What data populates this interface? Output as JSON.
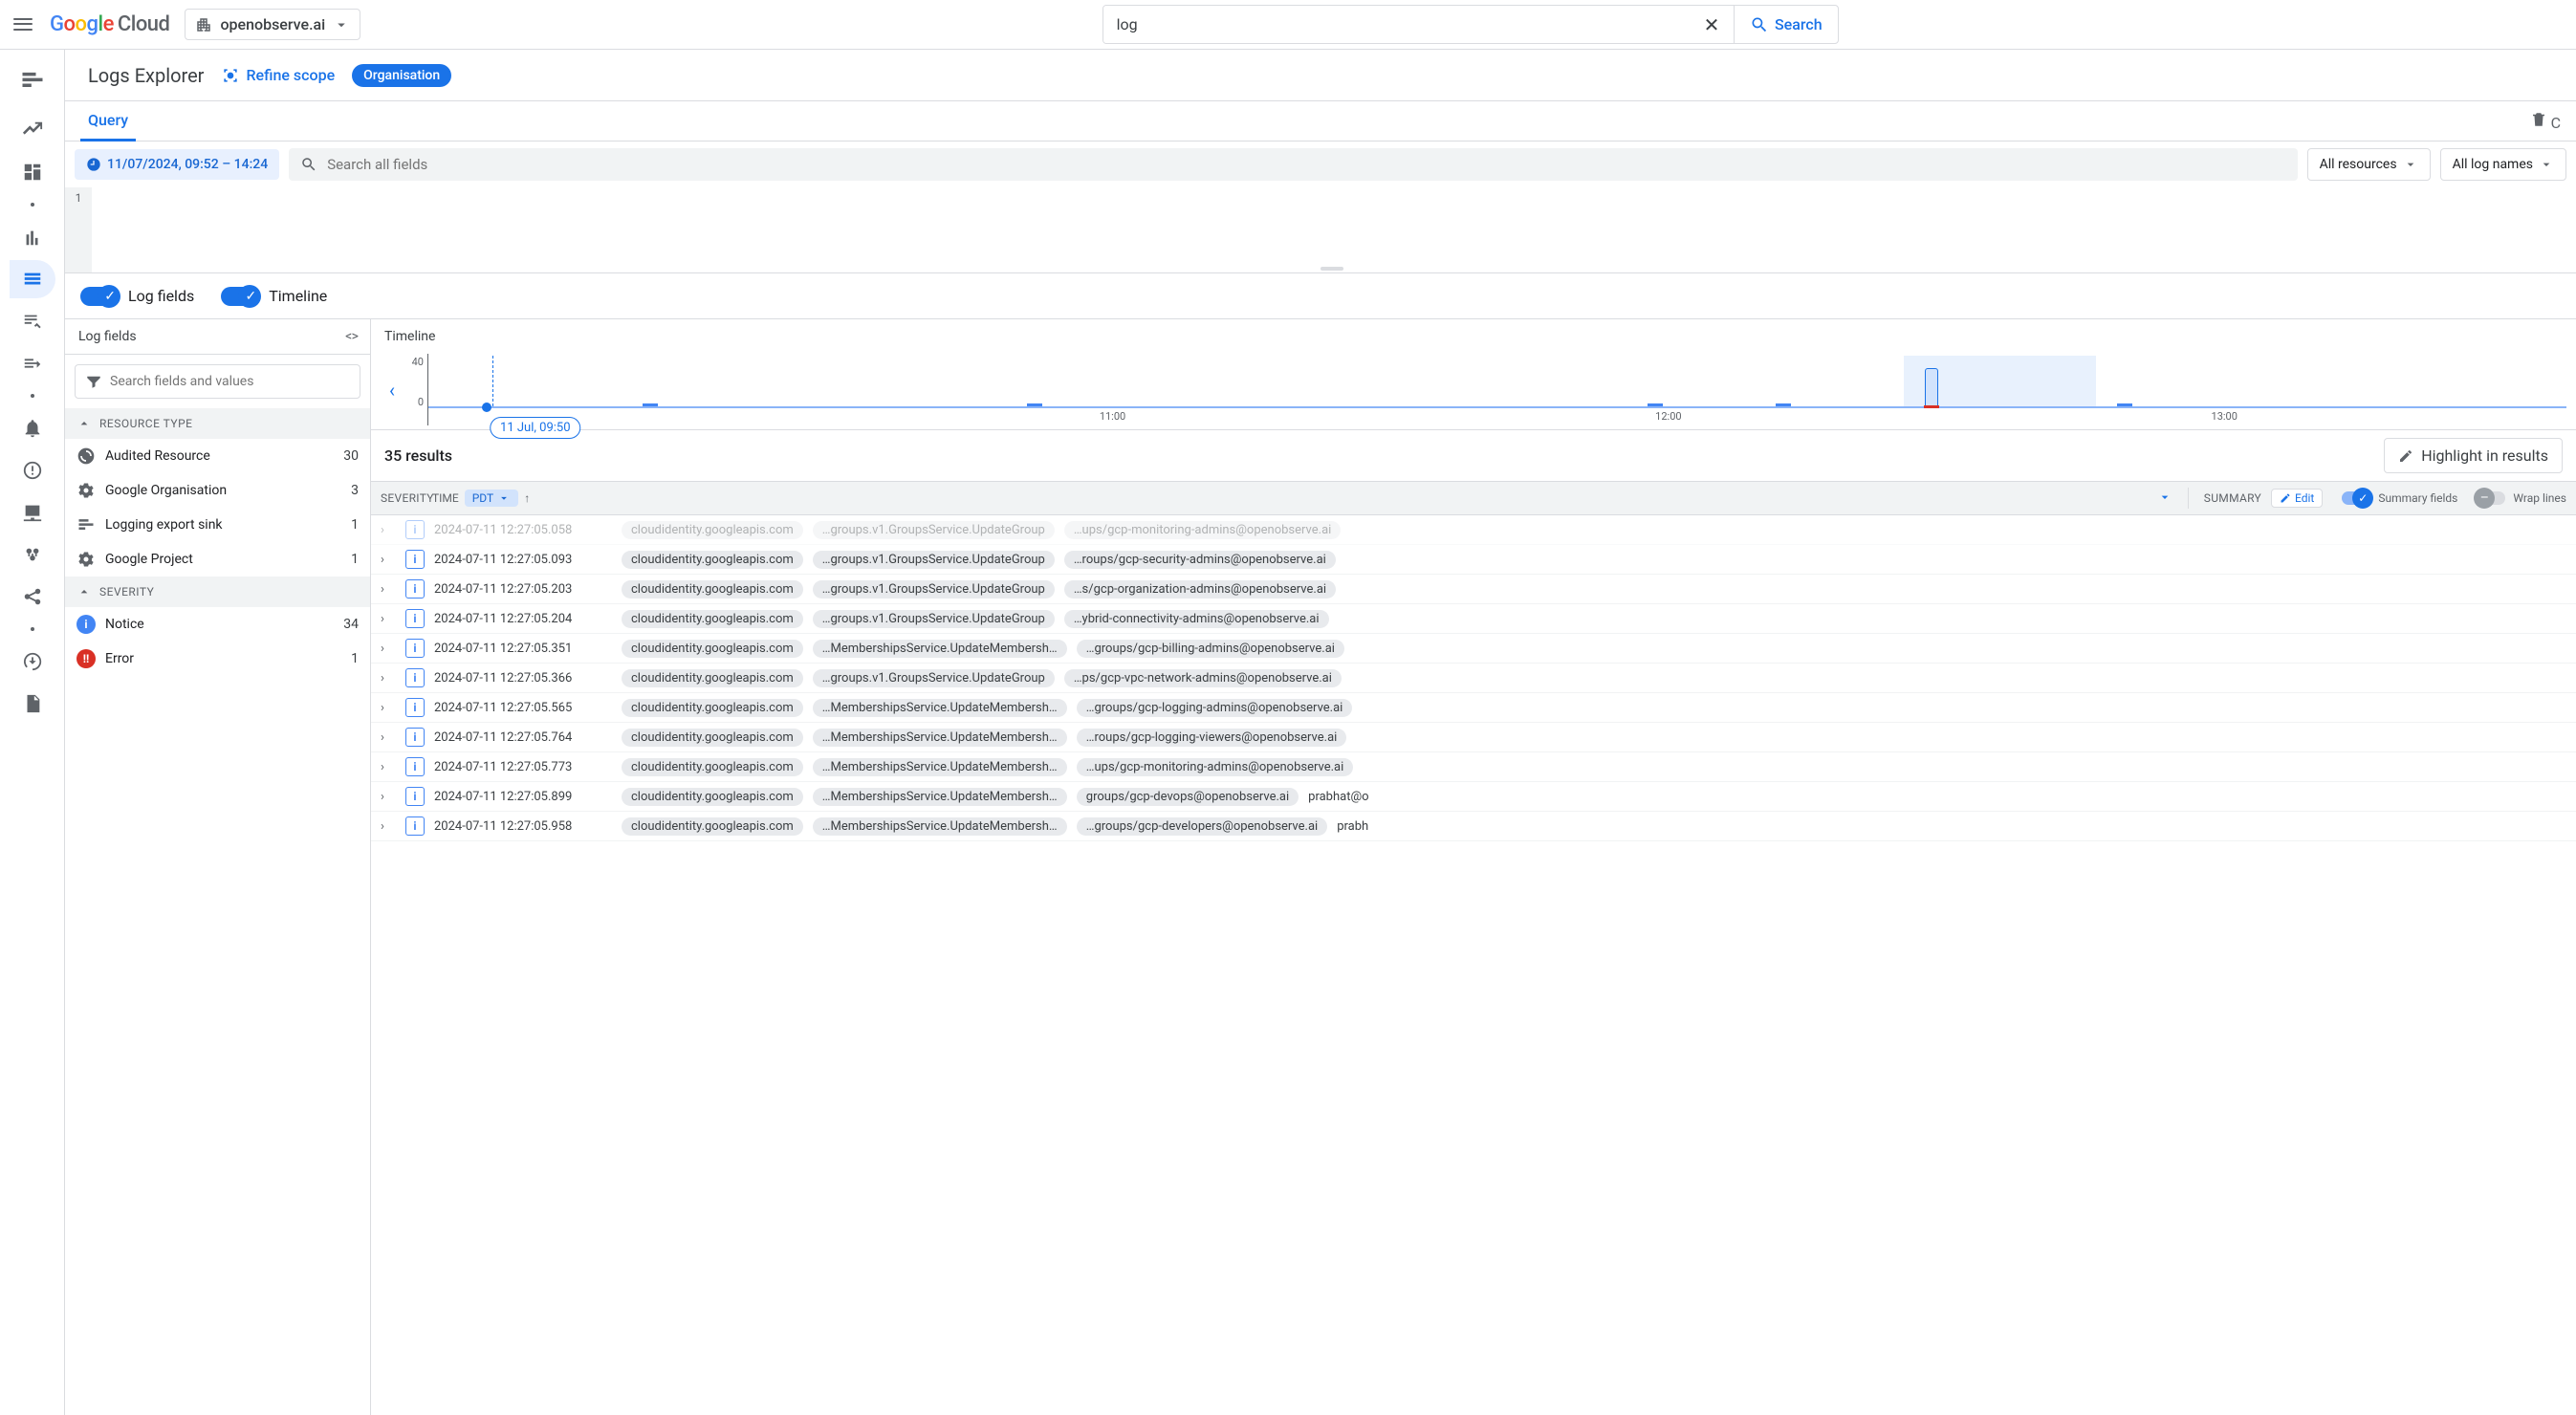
{
  "topbar": {
    "logo_text": "Google Cloud",
    "project": "openobserve.ai",
    "search_value": "log",
    "search_button": "Search"
  },
  "page": {
    "title": "Logs Explorer",
    "refine_scope": "Refine scope",
    "scope_badge": "Organisation",
    "query_tab": "Query",
    "clear_label": "C"
  },
  "filters": {
    "time_range": "11/07/2024, 09:52 – 14:24",
    "search_placeholder": "Search all fields",
    "resources_dd": "All resources",
    "lognames_dd": "All log names",
    "editor_line": "1"
  },
  "toggles": {
    "log_fields": "Log fields",
    "timeline": "Timeline"
  },
  "fields_panel": {
    "header": "Log fields",
    "search_placeholder": "Search fields and values",
    "groups": [
      {
        "name": "RESOURCE TYPE",
        "items": [
          {
            "icon": "audited",
            "label": "Audited Resource",
            "count": "30"
          },
          {
            "icon": "gear",
            "label": "Google Organisation",
            "count": "3"
          },
          {
            "icon": "sink",
            "label": "Logging export sink",
            "count": "1"
          },
          {
            "icon": "gear",
            "label": "Google Project",
            "count": "1"
          }
        ]
      },
      {
        "name": "SEVERITY",
        "items": [
          {
            "icon": "notice",
            "label": "Notice",
            "count": "34"
          },
          {
            "icon": "error",
            "label": "Error",
            "count": "1"
          }
        ]
      }
    ]
  },
  "timeline": {
    "title": "Timeline",
    "y_max": "40",
    "y_min": "0",
    "start_label": "11 Jul, 09:50",
    "xticks": [
      "11:00",
      "12:00",
      "13:00"
    ]
  },
  "results": {
    "count_text": "35 results",
    "highlight": "Highlight in results",
    "th_severity": "SEVERITY",
    "th_time": "TIME",
    "tz": "PDT",
    "th_summary": "SUMMARY",
    "edit": "Edit",
    "summary_fields": "Summary fields",
    "wrap_lines": "Wrap lines",
    "rows": [
      {
        "faded": true,
        "ts": "2024-07-11 12:27:05.058",
        "svc": "cloudidentity.googleapis.com",
        "method": "…groups.v1.GroupsService.UpdateGroup",
        "email": "…ups/gcp-monitoring-admins@openobserve.ai",
        "trail": ""
      },
      {
        "faded": false,
        "ts": "2024-07-11 12:27:05.093",
        "svc": "cloudidentity.googleapis.com",
        "method": "…groups.v1.GroupsService.UpdateGroup",
        "email": "…roups/gcp-security-admins@openobserve.ai",
        "trail": ""
      },
      {
        "faded": false,
        "ts": "2024-07-11 12:27:05.203",
        "svc": "cloudidentity.googleapis.com",
        "method": "…groups.v1.GroupsService.UpdateGroup",
        "email": "…s/gcp-organization-admins@openobserve.ai",
        "trail": ""
      },
      {
        "faded": false,
        "ts": "2024-07-11 12:27:05.204",
        "svc": "cloudidentity.googleapis.com",
        "method": "…groups.v1.GroupsService.UpdateGroup",
        "email": "…ybrid-connectivity-admins@openobserve.ai",
        "trail": ""
      },
      {
        "faded": false,
        "ts": "2024-07-11 12:27:05.351",
        "svc": "cloudidentity.googleapis.com",
        "method": "…MembershipsService.UpdateMembership",
        "email": "…groups/gcp-billing-admins@openobserve.ai",
        "trail": ""
      },
      {
        "faded": false,
        "ts": "2024-07-11 12:27:05.366",
        "svc": "cloudidentity.googleapis.com",
        "method": "…groups.v1.GroupsService.UpdateGroup",
        "email": "…ps/gcp-vpc-network-admins@openobserve.ai",
        "trail": ""
      },
      {
        "faded": false,
        "ts": "2024-07-11 12:27:05.565",
        "svc": "cloudidentity.googleapis.com",
        "method": "…MembershipsService.UpdateMembership",
        "email": "…groups/gcp-logging-admins@openobserve.ai",
        "trail": ""
      },
      {
        "faded": false,
        "ts": "2024-07-11 12:27:05.764",
        "svc": "cloudidentity.googleapis.com",
        "method": "…MembershipsService.UpdateMembership",
        "email": "…roups/gcp-logging-viewers@openobserve.ai",
        "trail": ""
      },
      {
        "faded": false,
        "ts": "2024-07-11 12:27:05.773",
        "svc": "cloudidentity.googleapis.com",
        "method": "…MembershipsService.UpdateMembership",
        "email": "…ups/gcp-monitoring-admins@openobserve.ai",
        "trail": ""
      },
      {
        "faded": false,
        "ts": "2024-07-11 12:27:05.899",
        "svc": "cloudidentity.googleapis.com",
        "method": "…MembershipsService.UpdateMembership",
        "email": "groups/gcp-devops@openobserve.ai",
        "trail": "prabhat@o"
      },
      {
        "faded": false,
        "ts": "2024-07-11 12:27:05.958",
        "svc": "cloudidentity.googleapis.com",
        "method": "…MembershipsService.UpdateMembership",
        "email": "…groups/gcp-developers@openobserve.ai",
        "trail": "prabh"
      }
    ]
  },
  "chart_data": {
    "type": "bar",
    "title": "Timeline",
    "xlabel": "",
    "ylabel": "",
    "ylim": [
      0,
      40
    ],
    "x_range": [
      "09:50",
      "14:24"
    ],
    "xticks": [
      "11:00",
      "12:00",
      "13:00"
    ],
    "bars": [
      {
        "time": "10:10",
        "count": 2,
        "error": 0
      },
      {
        "time": "10:40",
        "count": 2,
        "error": 0
      },
      {
        "time": "11:55",
        "count": 2,
        "error": 0
      },
      {
        "time": "12:05",
        "count": 2,
        "error": 0
      },
      {
        "time": "12:27",
        "count": 35,
        "error": 1,
        "selected": true
      },
      {
        "time": "12:45",
        "count": 2,
        "error": 0
      }
    ]
  }
}
